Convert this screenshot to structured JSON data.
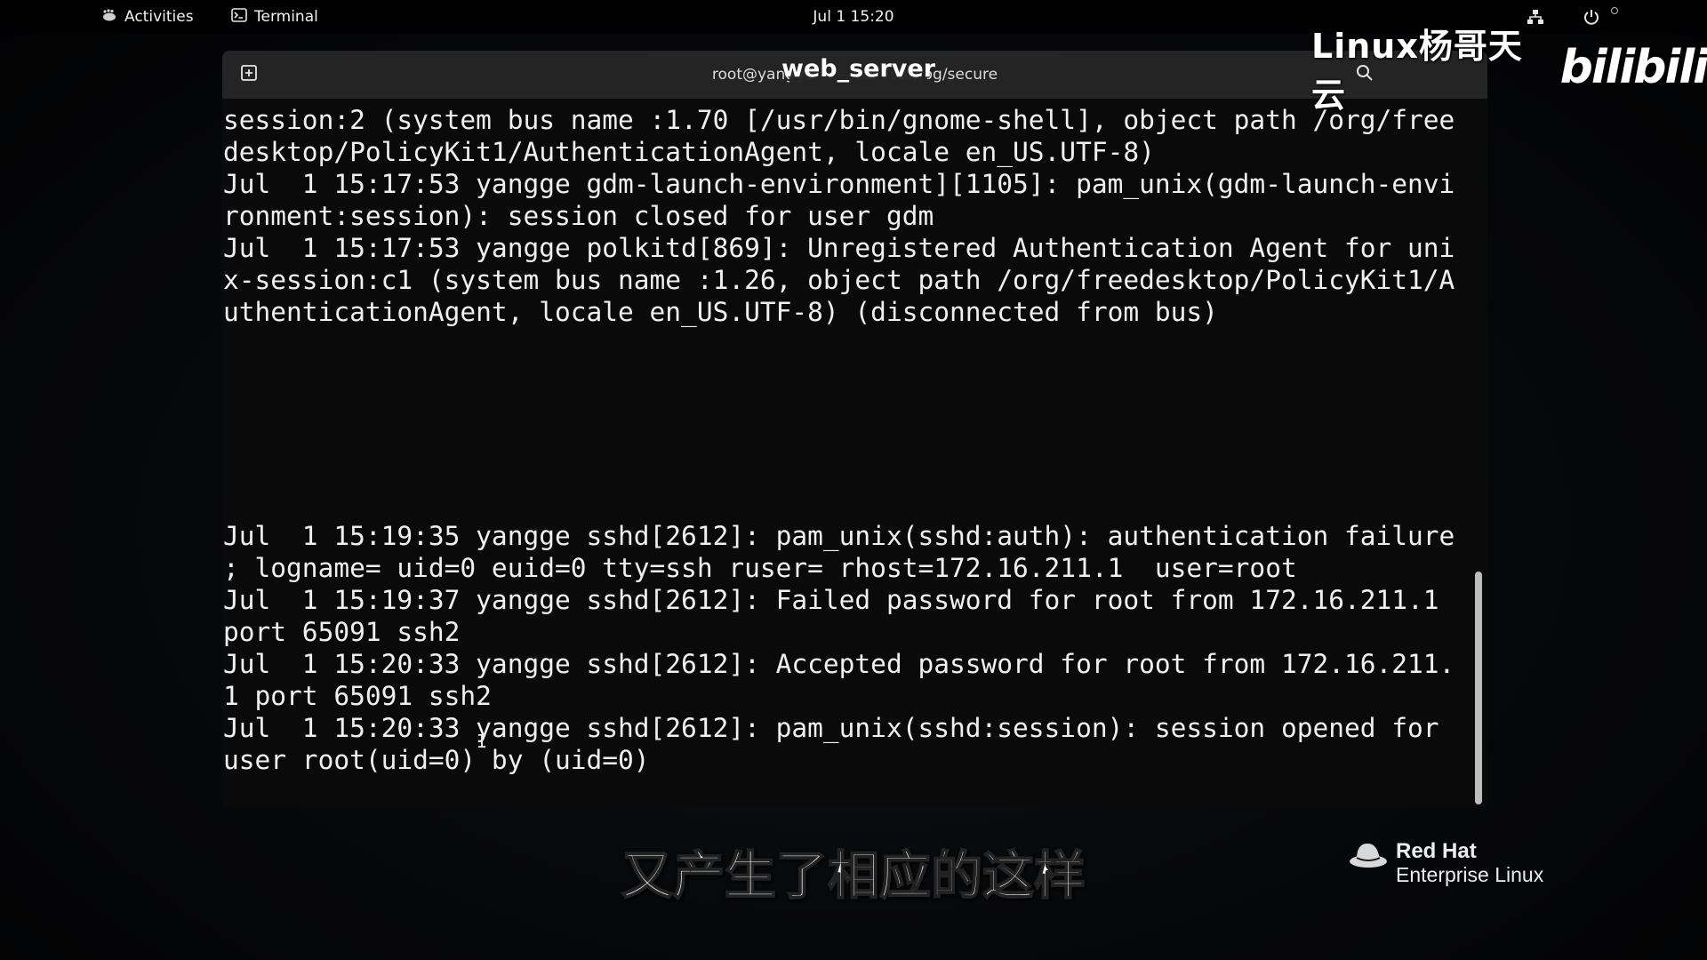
{
  "topbar": {
    "activities_label": "Activities",
    "app_label": "Terminal",
    "clock": "Jul 1  15:20",
    "icons": [
      "network-icon",
      "power-icon"
    ]
  },
  "window": {
    "title": "root@yangge:~ — tail /var/log/secure",
    "overlay_title": "web_server",
    "icons": [
      "new-tab-icon",
      "search-icon"
    ]
  },
  "terminal": {
    "lines": [
      "session:2 (system bus name :1.70 [/usr/bin/gnome-shell], object path /org/free",
      "desktop/PolicyKit1/AuthenticationAgent, locale en_US.UTF-8)",
      "Jul  1 15:17:53 yangge gdm-launch-environment][1105]: pam_unix(gdm-launch-envi",
      "ronment:session): session closed for user gdm",
      "Jul  1 15:17:53 yangge polkitd[869]: Unregistered Authentication Agent for uni",
      "x-session:c1 (system bus name :1.26, object path /org/freedesktop/PolicyKit1/A",
      "uthenticationAgent, locale en_US.UTF-8) (disconnected from bus)",
      "",
      "",
      "",
      "",
      "",
      "",
      "Jul  1 15:19:35 yangge sshd[2612]: pam_unix(sshd:auth): authentication failure",
      "; logname= uid=0 euid=0 tty=ssh ruser= rhost=172.16.211.1  user=root",
      "Jul  1 15:19:37 yangge sshd[2612]: Failed password for root from 172.16.211.1",
      "port 65091 ssh2",
      "Jul  1 15:20:33 yangge sshd[2612]: Accepted password for root from 172.16.211.",
      "1 port 65091 ssh2",
      "Jul  1 15:20:33 yangge sshd[2612]: pam_unix(sshd:session): session opened for",
      "user root(uid=0) by (uid=0)"
    ]
  },
  "watermark": {
    "text": "Linux杨哥天云",
    "logo": "bilibili"
  },
  "subtitle": "又产生了相应的这样",
  "redhat": {
    "brand": "Red Hat",
    "product": "Enterprise Linux",
    "icon": "redhat-fedora-icon"
  }
}
